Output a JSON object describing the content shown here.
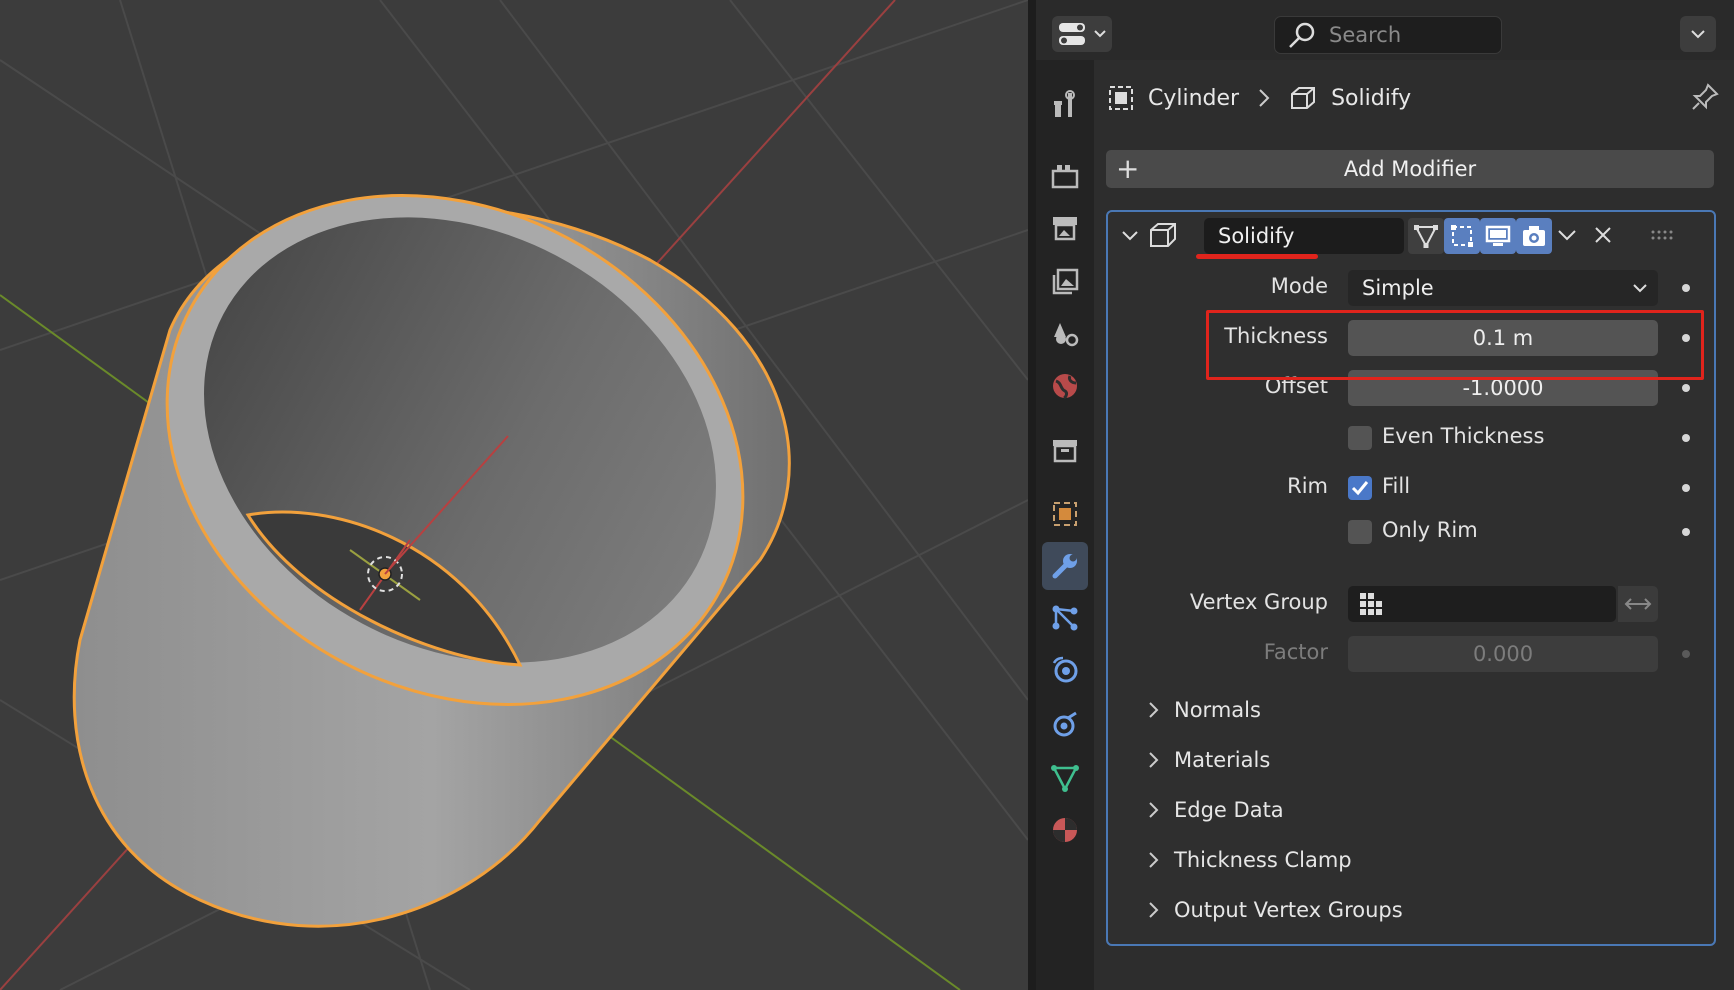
{
  "header": {
    "search_placeholder": "Search"
  },
  "breadcrumb": {
    "object": "Cylinder",
    "modifier": "Solidify"
  },
  "add_modifier_label": "Add Modifier",
  "modifier": {
    "name": "Solidify",
    "mode_label": "Mode",
    "mode_value": "Simple",
    "thickness_label": "Thickness",
    "thickness_value": "0.1 m",
    "offset_label": "Offset",
    "offset_value": "-1.0000",
    "even_thickness_label": "Even Thickness",
    "even_thickness_checked": false,
    "rim_label": "Rim",
    "fill_label": "Fill",
    "fill_checked": true,
    "only_rim_label": "Only Rim",
    "only_rim_checked": false,
    "vertex_group_label": "Vertex Group",
    "factor_label": "Factor",
    "factor_value": "0.000"
  },
  "subpanels": [
    "Normals",
    "Materials",
    "Edge Data",
    "Thickness Clamp",
    "Output Vertex Groups"
  ],
  "colors": {
    "accent_blue": "#4a78c8",
    "highlight_red": "#e0241c",
    "selection_orange": "#f2a13c"
  }
}
